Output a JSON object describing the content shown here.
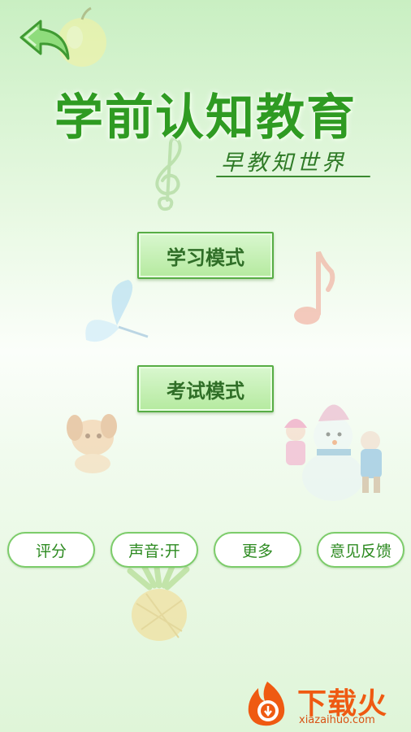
{
  "header": {
    "back_icon": "back-arrow-icon",
    "title": "学前认知教育",
    "subtitle": "早教知世界"
  },
  "modes": {
    "study_label": "学习模式",
    "exam_label": "考试模式"
  },
  "footer": {
    "rate_label": "评分",
    "sound_label": "声音:开",
    "more_label": "更多",
    "feedback_label": "意见反馈"
  },
  "watermark": {
    "name": "下载火",
    "url": "xiazaihuo.com"
  },
  "colors": {
    "accent": "#2f9b22",
    "button_border": "#57ad45",
    "pill_border": "#7ccc6a",
    "watermark": "#ef5a12"
  }
}
